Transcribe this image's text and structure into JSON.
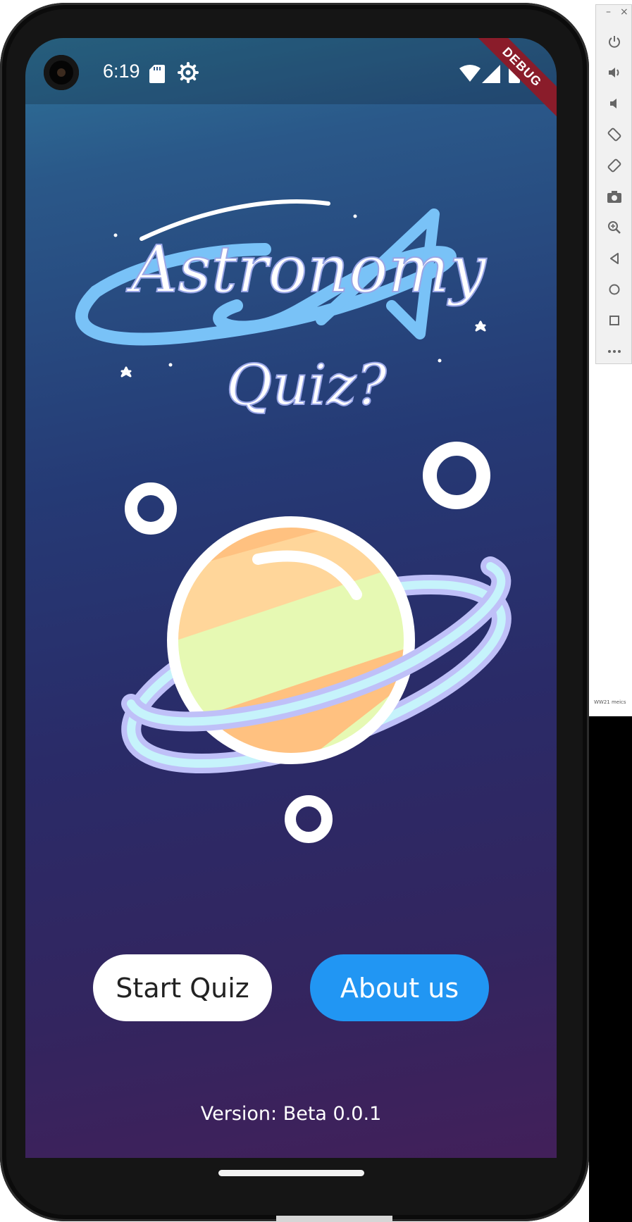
{
  "status_bar": {
    "time": "6:19",
    "icons": [
      "sim-card-icon",
      "gear-icon",
      "wifi-icon",
      "cell-signal-icon",
      "battery-icon"
    ]
  },
  "debug_banner": "DEBUG",
  "app": {
    "logo_line1": "Astronomy",
    "logo_line2": "Quiz?",
    "illustration": "saturn-planet-illustration",
    "buttons": {
      "start": "Start Quiz",
      "about": "About us"
    },
    "version": "Version: Beta 0.0.1"
  },
  "emulator_toolbar": {
    "minimize": "–",
    "close": "×",
    "tools": [
      "power-icon",
      "volume-up-icon",
      "volume-down-icon",
      "rotate-left-icon",
      "rotate-right-icon",
      "camera-icon",
      "zoom-icon",
      "back-icon",
      "home-icon",
      "overview-icon",
      "more-icon"
    ]
  },
  "side_strip_label": "WW21 meics",
  "colors": {
    "background_top": "#2f7499",
    "background_bottom": "#42205a",
    "about_button": "#2196f3",
    "start_button": "#ffffff",
    "logo_accent": "#79c2f7",
    "debug_ribbon": "#8a1c2a"
  }
}
